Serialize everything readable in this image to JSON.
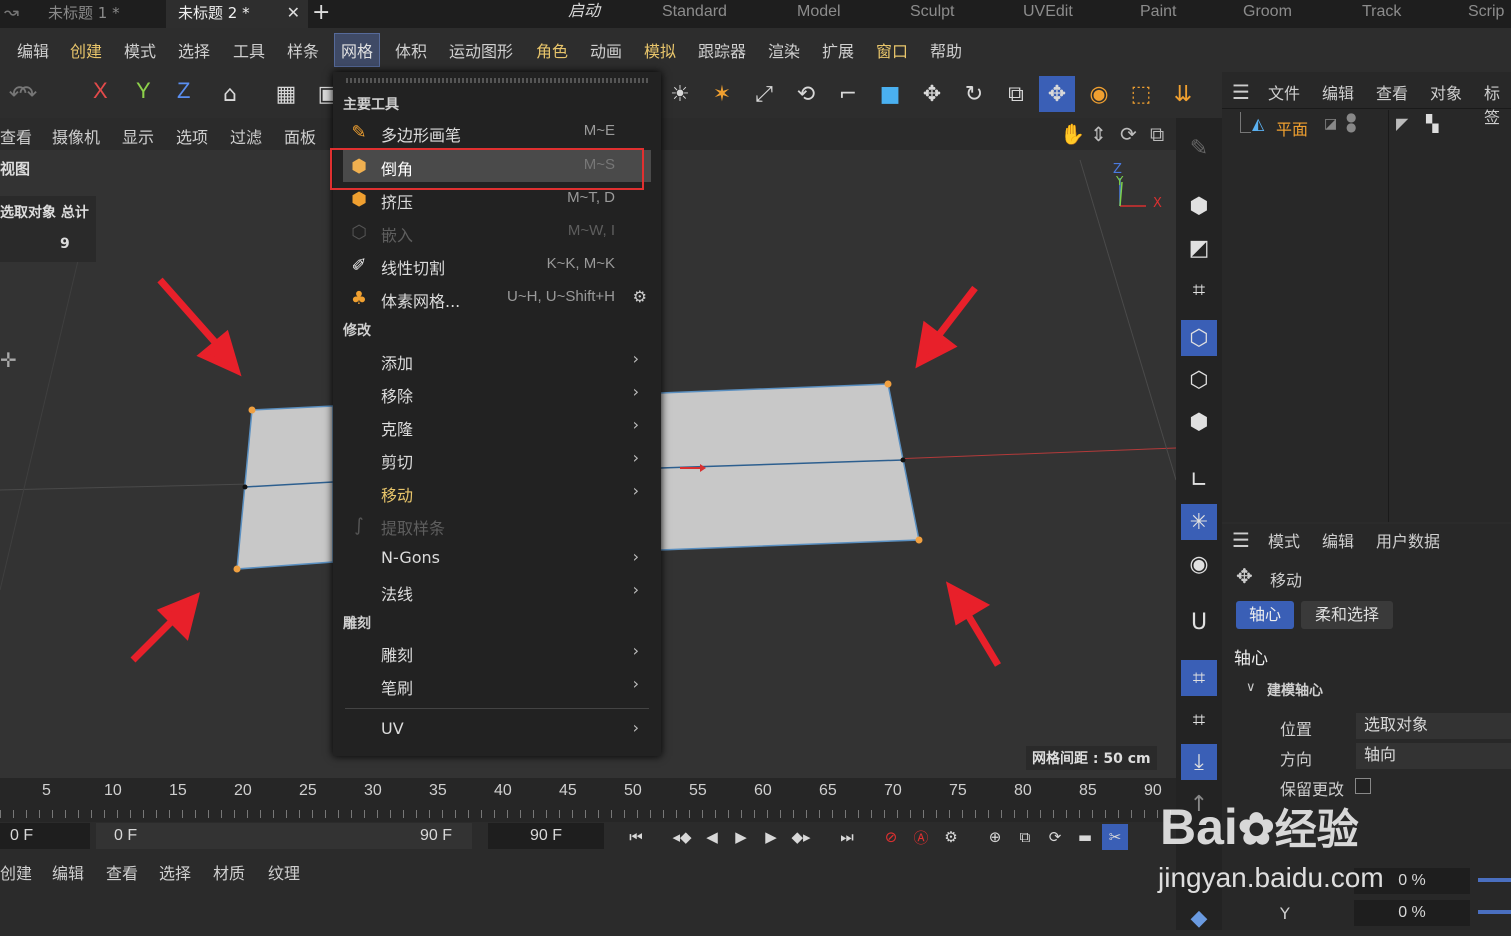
{
  "tabs": [
    {
      "label": "未标题 1 *"
    },
    {
      "label": "未标题 2 *"
    }
  ],
  "layouts": [
    "启动",
    "Standard",
    "Model",
    "Sculpt",
    "UVEdit",
    "Paint",
    "Groom",
    "Track",
    "Scrip"
  ],
  "menubar": [
    "编辑",
    "创建",
    "模式",
    "选择",
    "工具",
    "样条",
    "网格",
    "体积",
    "运动图形",
    "角色",
    "动画",
    "模拟",
    "跟踪器",
    "渲染",
    "扩展",
    "窗口",
    "帮助"
  ],
  "toolbar": {
    "axes": [
      "X",
      "Y",
      "Z"
    ]
  },
  "viewport_menu": [
    "查看",
    "摄像机",
    "显示",
    "选项",
    "过滤",
    "面板"
  ],
  "viewport": {
    "label": "视图",
    "stats_header": "选取对象 总计",
    "stats_value": "9",
    "grid_spacing": "网格间距 : 50 cm",
    "axis_z": "Z",
    "axis_y": "Y",
    "axis_x": "X"
  },
  "dropdown": {
    "sections": [
      "主要工具",
      "修改",
      "雕刻"
    ],
    "main_tools": [
      {
        "label": "多边形画笔",
        "shortcut": "M~E"
      },
      {
        "label": "倒角",
        "shortcut": "M~S"
      },
      {
        "label": "挤压",
        "shortcut": "M~T, D"
      },
      {
        "label": "嵌入",
        "shortcut": "M~W, I"
      },
      {
        "label": "线性切割",
        "shortcut": "K~K, M~K"
      },
      {
        "label": "体素网格...",
        "shortcut": "U~H, U~Shift+H"
      }
    ],
    "modify": [
      {
        "label": "添加"
      },
      {
        "label": "移除"
      },
      {
        "label": "克隆"
      },
      {
        "label": "剪切"
      },
      {
        "label": "移动"
      },
      {
        "label": "提取样条"
      },
      {
        "label": "N-Gons"
      },
      {
        "label": "法线"
      }
    ],
    "sculpt": [
      {
        "label": "雕刻"
      },
      {
        "label": "笔刷"
      }
    ],
    "uv": {
      "label": "UV"
    }
  },
  "object_panel": {
    "menu": [
      "文件",
      "编辑",
      "查看",
      "对象",
      "标签"
    ],
    "object_name": "平面"
  },
  "attr_panel": {
    "menu": [
      "模式",
      "编辑",
      "用户数据"
    ],
    "tool_name": "移动",
    "tabs": [
      "轴心",
      "柔和选择"
    ],
    "section_title": "轴心",
    "group": "建模轴心",
    "rows": [
      {
        "label": "位置",
        "value": "选取对象"
      },
      {
        "label": "方向",
        "value": "轴向"
      }
    ],
    "keep_changes": "保留更改",
    "y_label": "Y",
    "y_value": "0 %",
    "x_value": "0 %"
  },
  "timeline": {
    "ticks": [
      "5",
      "10",
      "15",
      "20",
      "25",
      "30",
      "35",
      "40",
      "45",
      "50",
      "55",
      "60",
      "65",
      "70",
      "75",
      "80",
      "85",
      "90"
    ]
  },
  "transport": {
    "current": "0 F",
    "start": "0 F",
    "end": "90 F",
    "end2": "90 F"
  },
  "bottom_menu": [
    "创建",
    "编辑",
    "查看",
    "选择",
    "材质",
    "纹理"
  ],
  "watermark": {
    "text1": "Bai",
    "text2": "经验",
    "url": "jingyan.baidu.com"
  },
  "colors": {
    "accent": "#3a5fb6",
    "highlight_box": "#e03030",
    "menu_yellow": "#e8c56b",
    "arrow_red": "#e8202a",
    "plane": "#c8c8c8"
  }
}
